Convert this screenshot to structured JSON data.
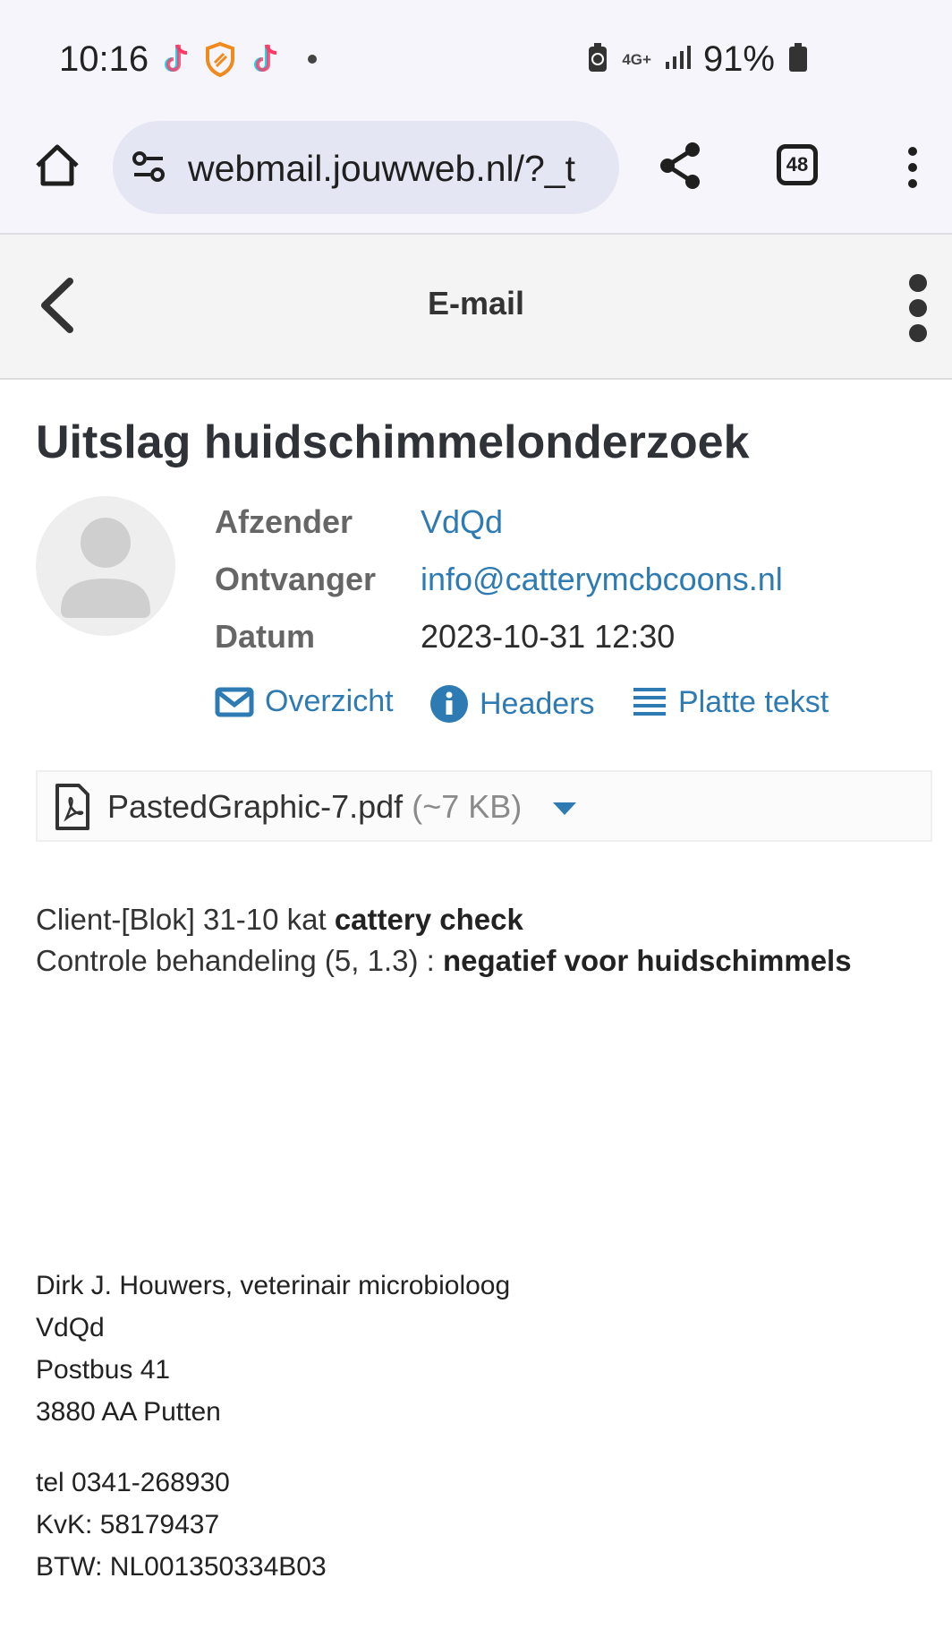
{
  "status_bar": {
    "time": "10:16",
    "left_icons": [
      "tiktok-icon",
      "shield-icon",
      "tiktok-icon"
    ],
    "network": "4G+",
    "battery": "91%"
  },
  "browser": {
    "url": "webmail.jouwweb.nl/?_t",
    "tab_count": "48"
  },
  "app_header": {
    "title": "E-mail"
  },
  "email": {
    "subject": "Uitslag huidschimmelonderzoek",
    "fields": {
      "from_label": "Afzender",
      "from_value": "VdQd",
      "to_label": "Ontvanger",
      "to_value": "info@catterymcbcoons.nl",
      "date_label": "Datum",
      "date_value": "2023-10-31 12:30"
    },
    "actions": {
      "overview": "Overzicht",
      "headers": "Headers",
      "plain_text": "Platte tekst"
    },
    "attachment": {
      "name": "PastedGraphic-7.pdf",
      "size": "(~7 KB)"
    },
    "body": {
      "line1_prefix": "Client-[Blok] 31-10 kat ",
      "line1_bold": "cattery check",
      "line2_prefix": "Controle behandeling (5, 1.3) : ",
      "line2_bold": "negatief voor huidschimmels"
    },
    "signature": {
      "name": "Dirk J. Houwers, veterinair microbioloog",
      "org": "VdQd",
      "postbus": "Postbus 41",
      "city": "3880 AA Putten",
      "tel": "tel 0341-268930",
      "kvk": "KvK: 58179437",
      "btw": "BTW: NL001350334B03"
    }
  },
  "colors": {
    "link": "#2e7bb3",
    "header_bg": "#f4f4f4",
    "browser_bg": "#f6f5fb",
    "url_bg": "#e4e6f3"
  }
}
